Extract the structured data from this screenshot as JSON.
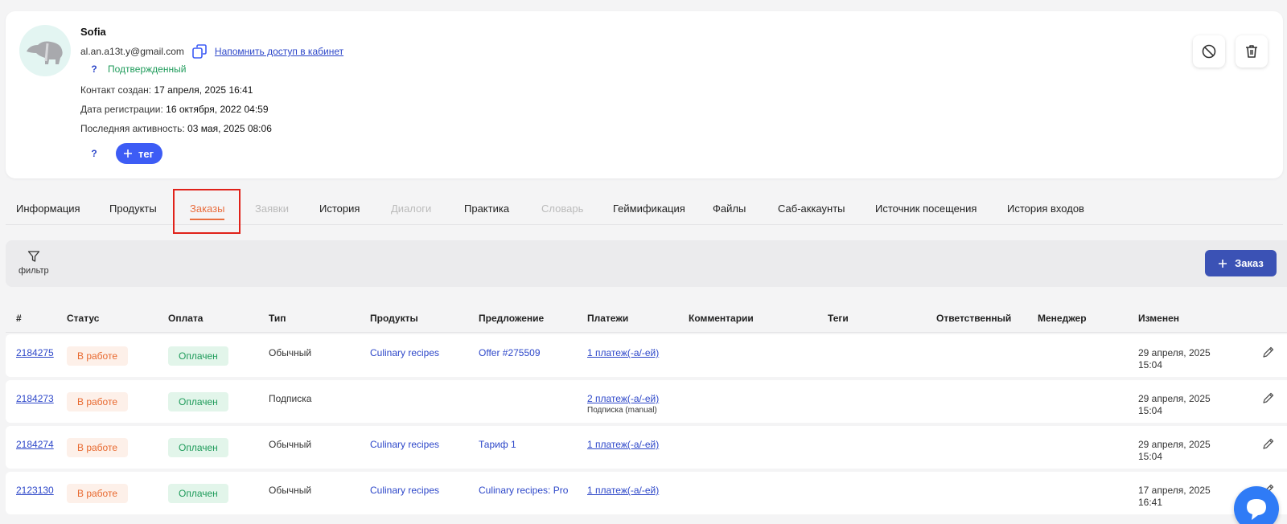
{
  "contact": {
    "name": "Sofia",
    "email": "al.an.a13t.y@gmail.com",
    "remind_access": "Напомнить доступ в кабинет",
    "question_mark": "?",
    "status": "Подтвержденный",
    "created_label": "Контакт создан:",
    "created_value": "17 апреля, 2025 16:41",
    "registered_label": "Дата регистрации:",
    "registered_value": "16 октября, 2022 04:59",
    "last_activity_label": "Последняя активность:",
    "last_activity_value": "03 мая, 2025 08:06",
    "tag_question": "?",
    "add_tag_label": "тег"
  },
  "tabs": [
    {
      "label": "Информация",
      "state": "normal"
    },
    {
      "label": "Продукты",
      "state": "normal"
    },
    {
      "label": "Заказы",
      "state": "active"
    },
    {
      "label": "Заявки",
      "state": "disabled"
    },
    {
      "label": "История",
      "state": "normal"
    },
    {
      "label": "Диалоги",
      "state": "disabled"
    },
    {
      "label": "Практика",
      "state": "normal"
    },
    {
      "label": "Словарь",
      "state": "disabled"
    },
    {
      "label": "Геймификация",
      "state": "normal"
    },
    {
      "label": "Файлы",
      "state": "normal"
    },
    {
      "label": "Саб-аккаунты",
      "state": "normal"
    },
    {
      "label": "Источник посещения",
      "state": "normal"
    },
    {
      "label": "История входов",
      "state": "normal"
    }
  ],
  "toolbar": {
    "filter_label": "фильтр",
    "add_order_label": "Заказ"
  },
  "table": {
    "headers": [
      "#",
      "Статус",
      "Оплата",
      "Тип",
      "Продукты",
      "Предложение",
      "Платежи",
      "Комментарии",
      "Теги",
      "Ответственный",
      "Менеджер",
      "Изменен"
    ],
    "rows": [
      {
        "id": "2184275",
        "status": "В работе",
        "payment": "Оплачен",
        "type": "Обычный",
        "products": "Culinary recipes",
        "offer": "Offer #275509",
        "payments": "1 платеж(-а/-ей)",
        "payments_sub": "",
        "changed_date": "29 апреля, 2025",
        "changed_time": "15:04"
      },
      {
        "id": "2184273",
        "status": "В работе",
        "payment": "Оплачен",
        "type": "Подписка",
        "products": "",
        "offer": "",
        "payments": "2 платеж(-а/-ей)",
        "payments_sub": "Подписка (manual)",
        "changed_date": "29 апреля, 2025",
        "changed_time": "15:04"
      },
      {
        "id": "2184274",
        "status": "В работе",
        "payment": "Оплачен",
        "type": "Обычный",
        "products": "Culinary recipes",
        "offer": "Тариф 1",
        "payments": "1 платеж(-а/-ей)",
        "payments_sub": "",
        "changed_date": "29 апреля, 2025",
        "changed_time": "15:04"
      },
      {
        "id": "2123130",
        "status": "В работе",
        "payment": "Оплачен",
        "type": "Обычный",
        "products": "Culinary recipes",
        "offer": "Culinary recipes: Pro",
        "payments": "1 платеж(-а/-ей)",
        "payments_sub": "",
        "changed_date": "17 апреля, 2025",
        "changed_time": "16:41"
      }
    ]
  },
  "colors": {
    "accent": "#3d5cf5",
    "active_tab": "#e96e3f",
    "status_work": "#e8692f",
    "status_paid": "#1e9b5a",
    "link": "#2d47c9"
  }
}
